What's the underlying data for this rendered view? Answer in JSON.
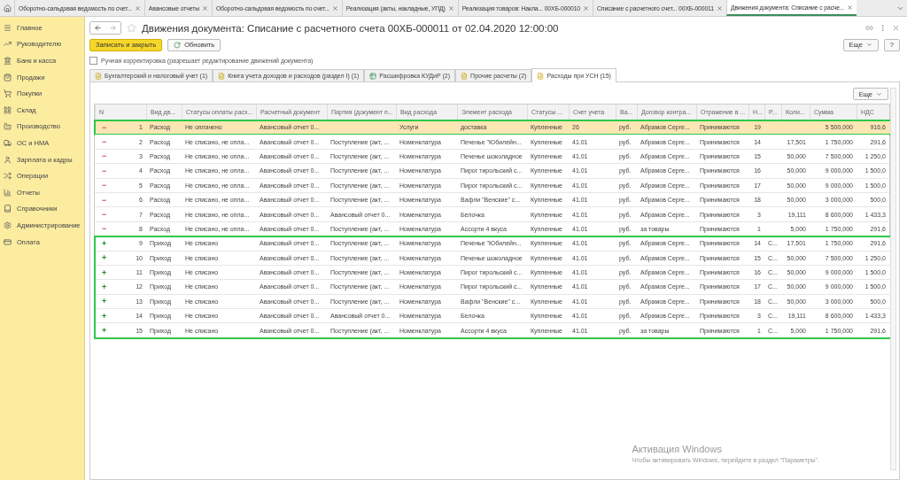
{
  "top_tabs": [
    {
      "label": "Оборотно-сальдовая ведомость по счет...",
      "selected": false
    },
    {
      "label": "Авансовые отчеты",
      "selected": false
    },
    {
      "label": "Оборотно-сальдовая ведомость по счет...",
      "selected": false
    },
    {
      "label": "Реализация (акты, накладные, УПД)",
      "selected": false
    },
    {
      "label": "Реализация товаров: Накла... 00ХБ-000010",
      "selected": false
    },
    {
      "label": "Списание с расчетного счет... 00ХБ-000011",
      "selected": false
    },
    {
      "label": "Движения документа: Списание с расче...",
      "selected": true
    }
  ],
  "sidebar": {
    "items": [
      {
        "label": "Главное",
        "kind": "menu"
      },
      {
        "label": "Руководителю",
        "kind": "chart"
      },
      {
        "label": "Банк и касса",
        "kind": "bank"
      },
      {
        "label": "Продажи",
        "kind": "bag"
      },
      {
        "label": "Покупки",
        "kind": "cart"
      },
      {
        "label": "Склад",
        "kind": "grid"
      },
      {
        "label": "Производство",
        "kind": "factory"
      },
      {
        "label": "ОС и НМА",
        "kind": "truck"
      },
      {
        "label": "Зарплата и кадры",
        "kind": "user"
      },
      {
        "label": "Операции",
        "kind": "ops"
      },
      {
        "label": "Отчеты",
        "kind": "bars"
      },
      {
        "label": "Справочники",
        "kind": "book"
      },
      {
        "label": "Администрирование",
        "kind": "gear"
      },
      {
        "label": "Оплата",
        "kind": "card"
      }
    ]
  },
  "window": {
    "title": "Движения документа: Списание с расчетного счета 00ХБ-000011 от 02.04.2020 12:00:00"
  },
  "toolbar": {
    "save": "Записать и закрыть",
    "refresh": "Обновить",
    "more": "Еще",
    "help": "?"
  },
  "manual_edit": {
    "label": "Ручная корректировка (разрешает редактирование движений документа)",
    "checked": false
  },
  "register_tabs": [
    {
      "label": "Бухгалтерский и налоговый учет (1)",
      "selected": false
    },
    {
      "label": "Книга учета доходов и расходов (раздел I) (1)",
      "selected": false
    },
    {
      "label": "Расшифровка КУДиР (2)",
      "selected": false
    },
    {
      "label": "Прочие расчеты (2)",
      "selected": false
    },
    {
      "label": "Расходы при УСН (15)",
      "selected": true
    }
  ],
  "table": {
    "more": "Еще",
    "columns": [
      "N",
      "Вид дв...",
      "Статусы оплаты расх...",
      "Расчетный документ",
      "Партия (документ п...",
      "Вид расхода",
      "Элемент расхода",
      "Статусы ...",
      "Счет учета",
      "Ва...",
      "Договор контра...",
      "Отражение в ...",
      "Н...",
      "Р...",
      "Коли...",
      "Сумма",
      "НДС"
    ],
    "row_groups": [
      {
        "outlined": true,
        "rows": [
          {
            "kind": "expense",
            "selected": true,
            "cells": [
              "−",
              "1",
              "Расход",
              "Не оплачено",
              "Авансовый отчет 0...",
              "",
              "Услуги",
              "доставка",
              "Купленные",
              "26",
              "руб.",
              "Абрамов Серге...",
              "Принимаются",
              "19",
              "",
              "",
              "5 500,000",
              "916,6"
            ]
          }
        ]
      },
      {
        "rows": [
          {
            "kind": "expense",
            "selected": false,
            "cells": [
              "−",
              "2",
              "Расход",
              "Не списано, не опла...",
              "Авансовый отчет 0...",
              "Поступление (акт, ...",
              "Номенклатура",
              "Печенье \"Юбилейн...",
              "Купленные",
              "41.01",
              "руб.",
              "Абрамов Серге...",
              "Принимаются",
              "14",
              "",
              "17,501",
              "1 750,000",
              "291,6"
            ]
          },
          {
            "kind": "expense",
            "selected": false,
            "cells": [
              "−",
              "3",
              "Расход",
              "Не списано, не опла...",
              "Авансовый отчет 0...",
              "Поступление (акт, ...",
              "Номенклатура",
              "Печенье шоколадное",
              "Купленные",
              "41.01",
              "руб.",
              "Абрамов Серге...",
              "Принимаются",
              "15",
              "",
              "50,000",
              "7 500,000",
              "1 250,0"
            ]
          },
          {
            "kind": "expense",
            "selected": false,
            "cells": [
              "−",
              "4",
              "Расход",
              "Не списано, не опла...",
              "Авансовый отчет 0...",
              "Поступление (акт, ...",
              "Номенклатура",
              "Пирог тирольский с...",
              "Купленные",
              "41.01",
              "руб.",
              "Абрамов Серге...",
              "Принимаются",
              "16",
              "",
              "50,000",
              "9 000,000",
              "1 500,0"
            ]
          },
          {
            "kind": "expense",
            "selected": false,
            "cells": [
              "−",
              "5",
              "Расход",
              "Не списано, не опла...",
              "Авансовый отчет 0...",
              "Поступление (акт, ...",
              "Номенклатура",
              "Пирог тирольский с...",
              "Купленные",
              "41.01",
              "руб.",
              "Абрамов Серге...",
              "Принимаются",
              "17",
              "",
              "50,000",
              "9 000,000",
              "1 500,0"
            ]
          },
          {
            "kind": "expense",
            "selected": false,
            "cells": [
              "−",
              "6",
              "Расход",
              "Не списано, не опла...",
              "Авансовый отчет 0...",
              "Поступление (акт, ...",
              "Номенклатура",
              "Вафли \"Венские\" с...",
              "Купленные",
              "41.01",
              "руб.",
              "Абрамов Серге...",
              "Принимаются",
              "18",
              "",
              "50,000",
              "3 000,000",
              "500,0"
            ]
          },
          {
            "kind": "expense",
            "selected": false,
            "cells": [
              "−",
              "7",
              "Расход",
              "Не списано, не опла...",
              "Авансовый отчет 0...",
              "Авансовый отчет 0...",
              "Номенклатура",
              "Белочка",
              "Купленные",
              "41.01",
              "руб.",
              "Абрамов Серге...",
              "Принимаются",
              "3",
              "",
              "19,111",
              "8 600,000",
              "1 433,3"
            ]
          },
          {
            "kind": "expense",
            "selected": false,
            "cells": [
              "−",
              "8",
              "Расход",
              "Не списано, не опла...",
              "Авансовый отчет 0...",
              "Поступление (акт, ...",
              "Номенклатура",
              "Ассорти 4 вкуса",
              "Купленные",
              "41.01",
              "руб.",
              "за товары",
              "Принимаются",
              "1",
              "",
              "5,000",
              "1 750,000",
              "291,6"
            ]
          }
        ]
      },
      {
        "outlined": true,
        "rows": [
          {
            "kind": "income",
            "selected": false,
            "cells": [
              "+",
              "9",
              "Приход",
              "Не списано",
              "Авансовый отчет 0...",
              "Поступление (акт, ...",
              "Номенклатура",
              "Печенье \"Юбилейн...",
              "Купленные",
              "41.01",
              "руб.",
              "Абрамов Серге...",
              "Принимаются",
              "14",
              "С...",
              "17,501",
              "1 750,000",
              "291,6"
            ]
          },
          {
            "kind": "income",
            "selected": false,
            "cells": [
              "+",
              "10",
              "Приход",
              "Не списано",
              "Авансовый отчет 0...",
              "Поступление (акт, ...",
              "Номенклатура",
              "Печенье шоколадное",
              "Купленные",
              "41.01",
              "руб.",
              "Абрамов Серге...",
              "Принимаются",
              "15",
              "С...",
              "50,000",
              "7 500,000",
              "1 250,0"
            ]
          },
          {
            "kind": "income",
            "selected": false,
            "cells": [
              "+",
              "11",
              "Приход",
              "Не списано",
              "Авансовый отчет 0...",
              "Поступление (акт, ...",
              "Номенклатура",
              "Пирог тирольский с...",
              "Купленные",
              "41.01",
              "руб.",
              "Абрамов Серге...",
              "Принимаются",
              "16",
              "С...",
              "50,000",
              "9 000,000",
              "1 500,0"
            ]
          },
          {
            "kind": "income",
            "selected": false,
            "cells": [
              "+",
              "12",
              "Приход",
              "Не списано",
              "Авансовый отчет 0...",
              "Поступление (акт, ...",
              "Номенклатура",
              "Пирог тирольский с...",
              "Купленные",
              "41.01",
              "руб.",
              "Абрамов Серге...",
              "Принимаются",
              "17",
              "С...",
              "50,000",
              "9 000,000",
              "1 500,0"
            ]
          },
          {
            "kind": "income",
            "selected": false,
            "cells": [
              "+",
              "13",
              "Приход",
              "Не списано",
              "Авансовый отчет 0...",
              "Поступление (акт, ...",
              "Номенклатура",
              "Вафли \"Венские\" с...",
              "Купленные",
              "41.01",
              "руб.",
              "Абрамов Серге...",
              "Принимаются",
              "18",
              "С...",
              "50,000",
              "3 000,000",
              "500,0"
            ]
          },
          {
            "kind": "income",
            "selected": false,
            "cells": [
              "+",
              "14",
              "Приход",
              "Не списано",
              "Авансовый отчет 0...",
              "Авансовый отчет 0...",
              "Номенклатура",
              "Белочка",
              "Купленные",
              "41.01",
              "руб.",
              "Абрамов Серге...",
              "Принимаются",
              "3",
              "С...",
              "19,111",
              "8 600,000",
              "1 433,3"
            ]
          },
          {
            "kind": "income",
            "selected": false,
            "cells": [
              "+",
              "15",
              "Приход",
              "Не списано",
              "Авансовый отчет 0...",
              "Поступление (акт, ...",
              "Номенклатура",
              "Ассорти 4 вкуса",
              "Купленные",
              "41.01",
              "руб.",
              "за товары",
              "Принимаются",
              "1",
              "С...",
              "5,000",
              "1 750,000",
              "291,6"
            ]
          }
        ]
      }
    ]
  },
  "activation": {
    "title": "Активация Windows",
    "text": "Чтобы активировать Windows, перейдите в раздел \"Параметры\"."
  }
}
